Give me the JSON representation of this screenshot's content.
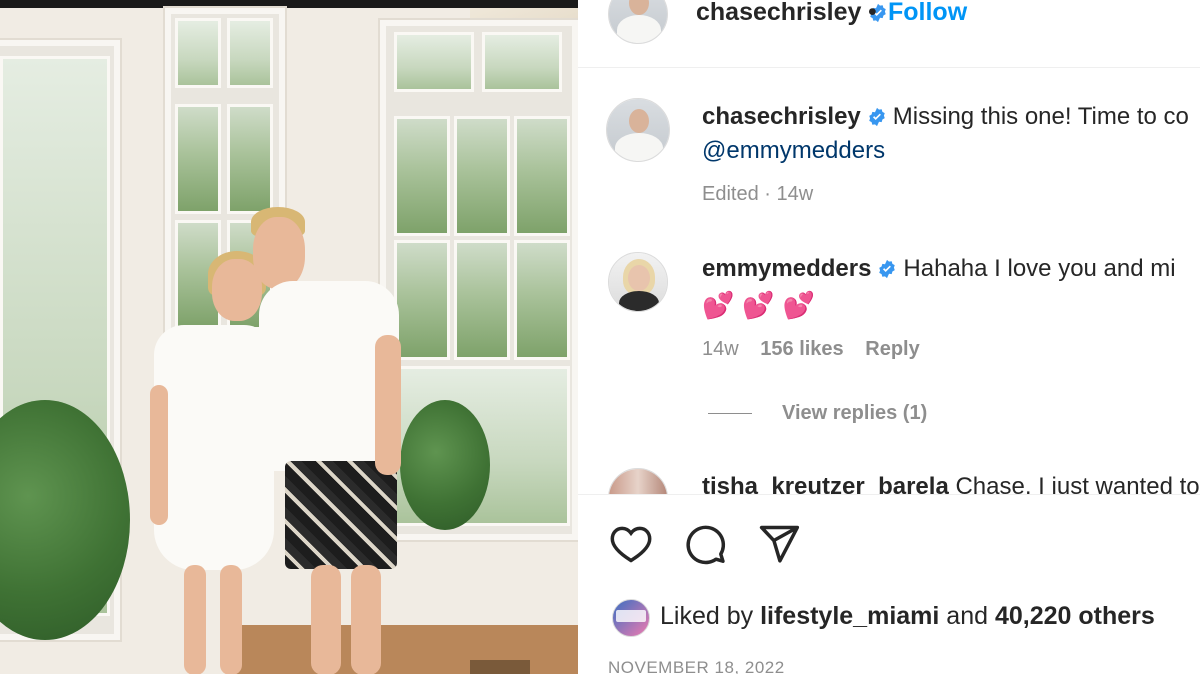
{
  "post": {
    "header": {
      "username": "chasechrisley",
      "separator": "•",
      "follow_label": "Follow"
    },
    "caption": {
      "username": "chasechrisley",
      "text": "Missing this one! Time to co",
      "mention": "@emmymedders",
      "edited": "Edited · 14w"
    },
    "comments": [
      {
        "username": "emmymedders",
        "text": "Hahaha I love you and mi",
        "emoji": "💕💕💕",
        "time": "14w",
        "likes": "156 likes",
        "reply_label": "Reply",
        "view_replies": "View replies (1)"
      },
      {
        "username": "tisha_kreutzer_barela",
        "text": "Chase, I just wanted to"
      }
    ],
    "actions": {
      "like_icon": "heart-icon",
      "comment_icon": "comment-bubble-icon",
      "share_icon": "paper-plane-icon"
    },
    "likes": {
      "prefix": "Liked by",
      "user": "lifestyle_miami",
      "middle": "and",
      "count": "40,220 others"
    },
    "date": "NOVEMBER 18, 2022"
  },
  "colors": {
    "accent": "#0095f6",
    "verified": "#3897f0",
    "mention": "#00376b",
    "muted": "#8e8e8e",
    "heart_emoji": "#e8315b"
  }
}
